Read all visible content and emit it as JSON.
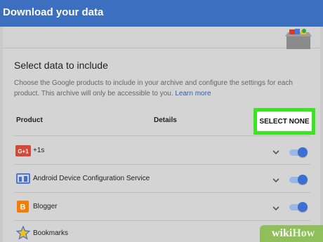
{
  "header": {
    "title": "Download your data"
  },
  "section": {
    "title": "Select data to include",
    "description": "Choose the Google products to include in your archive and configure the settings for each product. This archive will only be accessible to you.",
    "learn_more": "Learn more"
  },
  "table": {
    "col_product": "Product",
    "col_details": "Details",
    "select_none": "SELECT NONE"
  },
  "products": [
    {
      "label": "+1s",
      "icon": "google-plus-icon",
      "enabled": true
    },
    {
      "label": "Android Device Configuration Service",
      "icon": "android-device-icon",
      "enabled": true
    },
    {
      "label": "Blogger",
      "icon": "blogger-icon",
      "enabled": true
    },
    {
      "label": "Bookmarks",
      "icon": "bookmarks-star-icon",
      "enabled": true
    }
  ],
  "icons": {
    "google_plus_text": "G+1",
    "blogger_glyph": "B"
  },
  "watermark": {
    "wiki": "wiki",
    "how": "How"
  },
  "colors": {
    "header": "#3d6fc0",
    "highlight": "#39e51e",
    "toggle_on": "#3c6fd1",
    "link": "#2c5fb8"
  }
}
